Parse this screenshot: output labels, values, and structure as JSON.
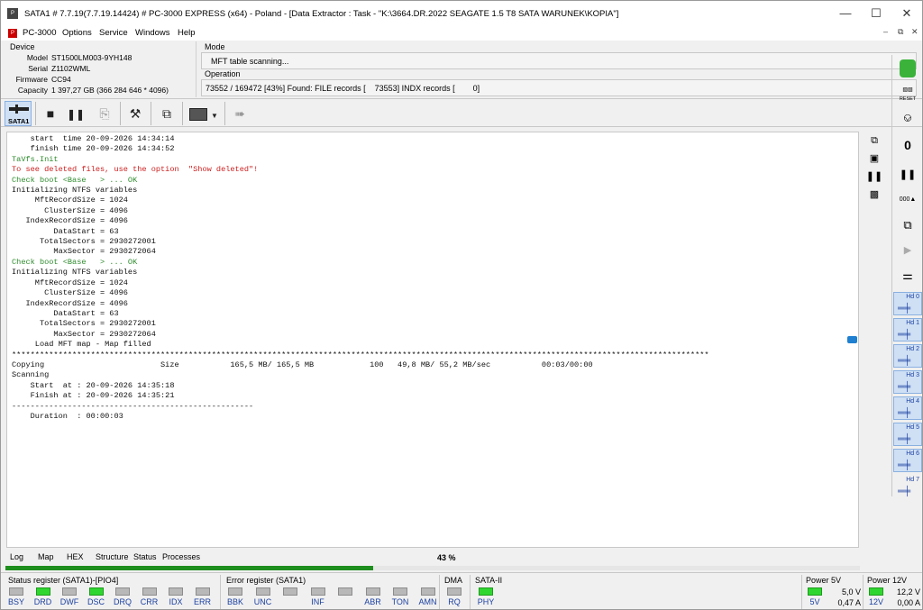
{
  "titlebar": {
    "app_icon": "pc3000-icon",
    "title": "SATA1 # 7.7.19(7.7.19.14424) # PC-3000 EXPRESS (x64) - Poland - [Data Extractor : Task - \"K:\\3664.DR.2022 SEAGATE 1.5 T8 SATA WARUNEK\\KOPIA\"]",
    "min": "—",
    "max": "☐",
    "close": "✕"
  },
  "menubar": {
    "items": [
      "PC-3000",
      "Options",
      "Service",
      "Windows",
      "Help"
    ],
    "mdi": [
      "–",
      "⧉",
      "✕"
    ]
  },
  "device": {
    "group": "Device",
    "model_label": "Model",
    "model": "ST1500LM003-9YH148",
    "serial_label": "Serial",
    "serial": "Z1102WML",
    "firmware_label": "Firmware",
    "firmware": "CC94",
    "capacity_label": "Capacity",
    "capacity": "1 397,27 GB (366 284 646 * 4096)"
  },
  "mode": {
    "group": "Mode",
    "value": "MFT table scanning..."
  },
  "operation": {
    "group": "Operation",
    "value": "73552 / 169472 [43%] Found: FILE records [    73553] INDX records [        0]"
  },
  "toolbar": {
    "sata1_label": "SATA1",
    "stop_icon": "stop-icon",
    "pause_icon": "pause-icon",
    "export_icon": "export-icon",
    "tools_icon": "tools-icon",
    "copy_icon": "copy-icon",
    "media_icon": "media-icon",
    "run_icon": "run-icon"
  },
  "log": {
    "lines": [
      {
        "t": "    start  time 20-09-2026 14:34:14",
        "c": ""
      },
      {
        "t": "    finish time 20-09-2026 14:34:52",
        "c": ""
      },
      {
        "t": "TaVfs.Init",
        "c": "g"
      },
      {
        "t": "To see deleted files, use the option  \"Show deleted\"!",
        "c": "r"
      },
      {
        "t": "Check boot <Base   > ... OK",
        "c": "g"
      },
      {
        "t": "Initializing NTFS variables",
        "c": ""
      },
      {
        "t": "     MftRecordSize = 1024",
        "c": ""
      },
      {
        "t": "       ClusterSize = 4096",
        "c": ""
      },
      {
        "t": "   IndexRecordSize = 4096",
        "c": ""
      },
      {
        "t": "         DataStart = 63",
        "c": ""
      },
      {
        "t": "      TotalSectors = 2930272001",
        "c": ""
      },
      {
        "t": "         MaxSector = 2930272064",
        "c": ""
      },
      {
        "t": "Check boot <Base   > ... OK",
        "c": "g"
      },
      {
        "t": "Initializing NTFS variables",
        "c": ""
      },
      {
        "t": "     MftRecordSize = 1024",
        "c": ""
      },
      {
        "t": "       ClusterSize = 4096",
        "c": ""
      },
      {
        "t": "   IndexRecordSize = 4096",
        "c": ""
      },
      {
        "t": "         DataStart = 63",
        "c": ""
      },
      {
        "t": "      TotalSectors = 2930272001",
        "c": ""
      },
      {
        "t": "         MaxSector = 2930272064",
        "c": ""
      },
      {
        "t": "     Load MFT map - Map filled",
        "c": ""
      },
      {
        "t": "******************************************************************************************************************************************************",
        "c": ""
      },
      {
        "t": "Copying                         Size           165,5 MB/ 165,5 MB            100   49,8 MB/ 55,2 MB/sec           00:03/00:00",
        "c": ""
      },
      {
        "t": "Scanning",
        "c": ""
      },
      {
        "t": "    Start  at : 20-09-2026 14:35:18",
        "c": ""
      },
      {
        "t": "    Finish at : 20-09-2026 14:35:21",
        "c": ""
      },
      {
        "t": "----------------------------------------------------",
        "c": ""
      },
      {
        "t": "    Duration  : 00:00:03",
        "c": ""
      }
    ]
  },
  "tabs": [
    "Log",
    "Map",
    "HEX",
    "Structure",
    "Status",
    "Processes"
  ],
  "progress": {
    "label": "43 %",
    "value": 0.43
  },
  "status": {
    "status_title": "Status register (SATA1)-[PIO4]",
    "status_leds": [
      {
        "n": "BSY",
        "on": false
      },
      {
        "n": "DRD",
        "on": true
      },
      {
        "n": "DWF",
        "on": false
      },
      {
        "n": "DSC",
        "on": true
      },
      {
        "n": "DRQ",
        "on": false
      },
      {
        "n": "CRR",
        "on": false
      },
      {
        "n": "IDX",
        "on": false
      },
      {
        "n": "ERR",
        "on": false
      }
    ],
    "error_title": "Error register (SATA1)",
    "error_leds": [
      {
        "n": "BBK",
        "on": false
      },
      {
        "n": "UNC",
        "on": false
      },
      {
        "n": "",
        "on": false
      },
      {
        "n": "INF",
        "on": false
      },
      {
        "n": "",
        "on": false
      },
      {
        "n": "ABR",
        "on": false
      },
      {
        "n": "TON",
        "on": false
      },
      {
        "n": "AMN",
        "on": false
      }
    ],
    "dma_title": "DMA",
    "dma_led": {
      "n": "RQ",
      "on": false
    },
    "sata_title": "SATA-II",
    "sata_led": {
      "n": "PHY",
      "on": true
    },
    "p5_title": "Power 5V",
    "p5_led": "5V",
    "p5_volt": "5,0 V",
    "p5_amp": "0,47 A",
    "p12_title": "Power 12V",
    "p12_led": "12V",
    "p12_volt": "12,2 V",
    "p12_amp": "0,00 A"
  },
  "sidebar": {
    "reset_label": "RESET",
    "hd_labels": [
      "Hd 0",
      "Hd 1",
      "Hd 2",
      "Hd 3",
      "Hd 4",
      "Hd 5",
      "Hd 6",
      "Hd 7"
    ]
  }
}
